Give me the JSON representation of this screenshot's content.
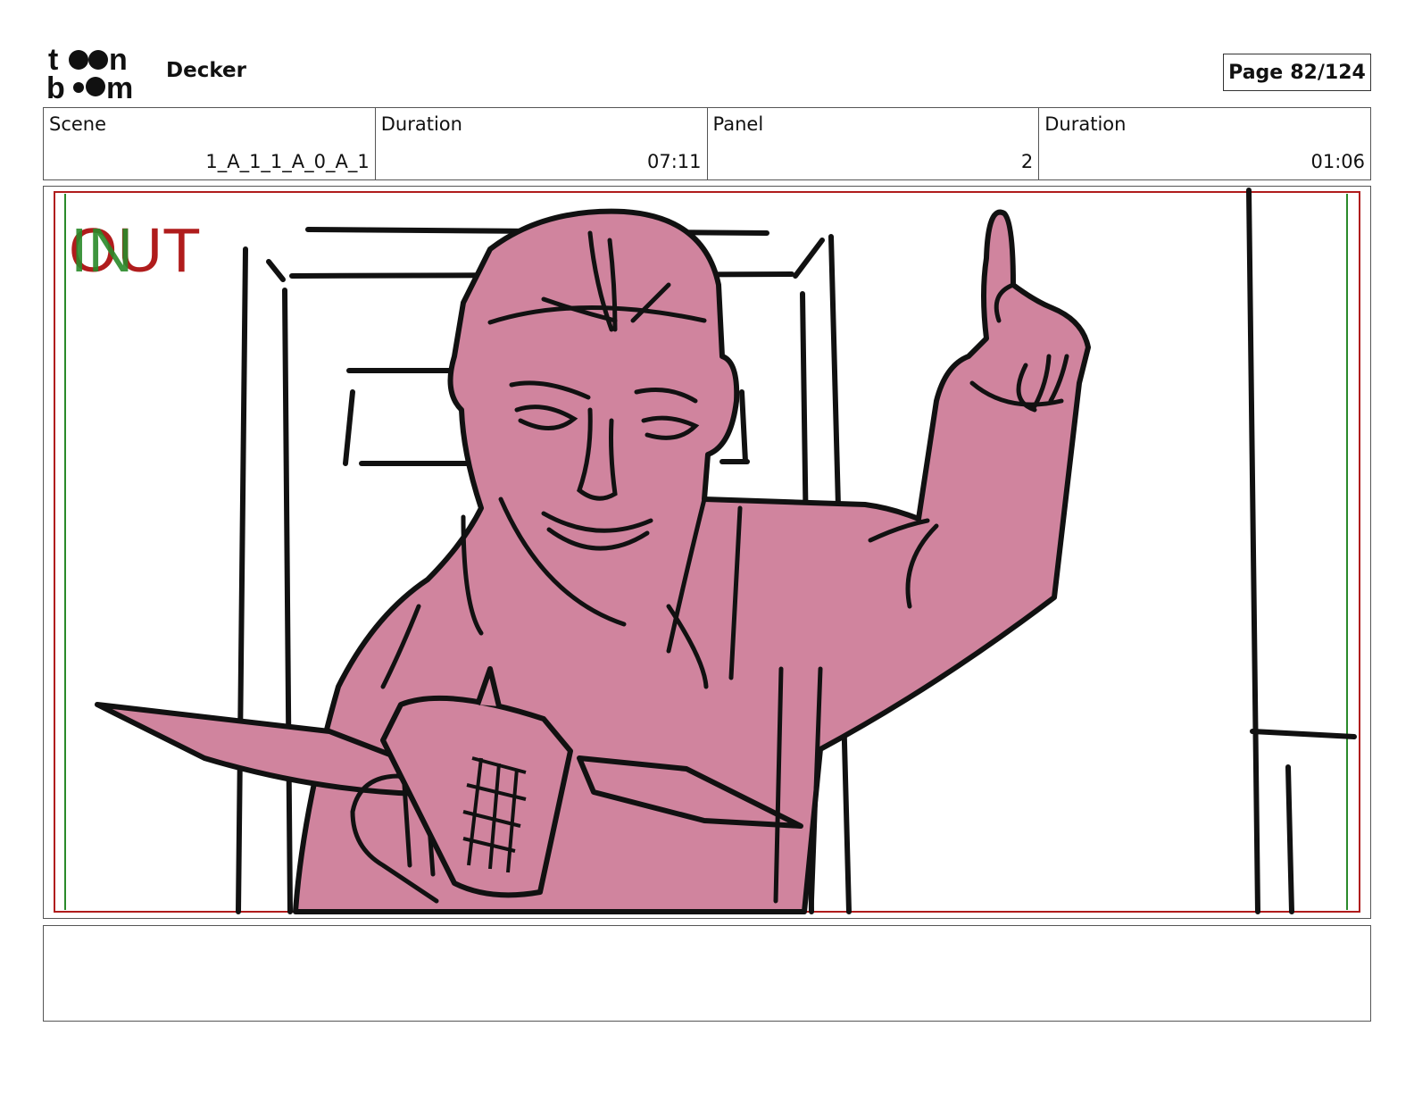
{
  "header": {
    "logo_text": "toon boom",
    "project_title": "Decker",
    "page_label": "Page",
    "page_number": "82/124"
  },
  "info": {
    "scene_label": "Scene",
    "scene_value": "1_A_1_1_A_0_A_1",
    "scene_duration_label": "Duration",
    "scene_duration_value": "07:11",
    "panel_label": "Panel",
    "panel_value": "2",
    "panel_duration_label": "Duration",
    "panel_duration_value": "01:06"
  },
  "panel": {
    "overlay_in": "IN",
    "overlay_out": "OUT"
  },
  "notes": {
    "text": ""
  },
  "colors": {
    "character_fill": "#d0849e",
    "safe_frame_red": "#b01c1c",
    "safe_frame_green": "#2a8a2a"
  }
}
